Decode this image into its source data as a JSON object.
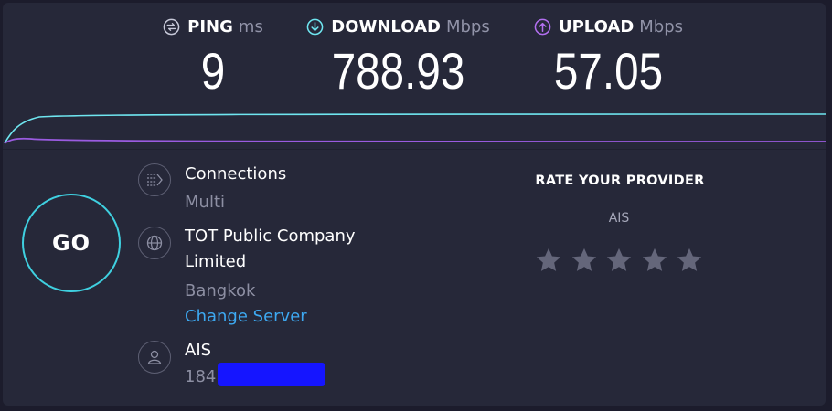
{
  "metrics": {
    "ping": {
      "label": "PING",
      "unit": "ms",
      "value": "9",
      "icon": "ping-icon",
      "color": "#c7c9d9"
    },
    "download": {
      "label": "DOWNLOAD",
      "unit": "Mbps",
      "value": "788.93",
      "icon": "download-arrow-icon",
      "color": "#6fe6f0"
    },
    "upload": {
      "label": "UPLOAD",
      "unit": "Mbps",
      "value": "57.05",
      "icon": "upload-arrow-icon",
      "color": "#b26ff0"
    }
  },
  "graph": {
    "download_color": "#6fe6f0",
    "upload_color": "#9a5be0"
  },
  "go_button": {
    "label": "GO",
    "accent": "#3fd0e0"
  },
  "connections": {
    "title": "Connections",
    "mode": "Multi",
    "icon": "connections-icon"
  },
  "server": {
    "name_line1": "TOT Public Company",
    "name_line2": "Limited",
    "location": "Bangkok",
    "change_label": "Change Server",
    "icon": "globe-icon"
  },
  "isp": {
    "name": "AIS",
    "ip_prefix": "184.",
    "icon": "user-icon"
  },
  "rate": {
    "title": "RATE YOUR PROVIDER",
    "provider": "AIS",
    "star_count": 5,
    "star_color": "#64667a"
  }
}
